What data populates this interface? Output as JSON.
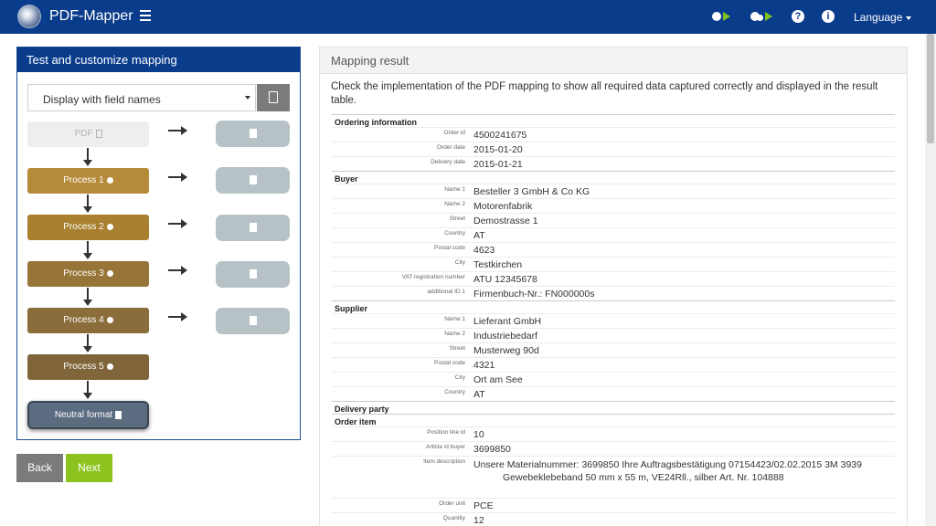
{
  "app": {
    "title": "PDF-Mapper",
    "language_label": "Language"
  },
  "toolbar": {
    "icons": [
      "gear-play-icon",
      "gears-play-icon",
      "help-icon",
      "info-icon"
    ],
    "help_glyph": "?",
    "info_glyph": "i"
  },
  "left_panel": {
    "title": "Test and customize mapping",
    "display_select": "Display with field names",
    "flow": {
      "pdf": "PDF",
      "processes": [
        "Process 1",
        "Process 2",
        "Process 3",
        "Process 4",
        "Process 5"
      ],
      "neutral": "Neutral format"
    },
    "colors": {
      "process": [
        "#b58a39",
        "#a8802f",
        "#977437",
        "#8b6d3b",
        "#7f6539"
      ]
    }
  },
  "buttons": {
    "back": "Back",
    "next": "Next"
  },
  "right_panel": {
    "title": "Mapping result",
    "intro": "Check the implementation of the PDF mapping to show all required data captured correctly and displayed in the result table.",
    "sections": {
      "ordering": {
        "title": "Ordering information",
        "rows": [
          {
            "label": "Order id",
            "value": "4500241675"
          },
          {
            "label": "Order date",
            "value": "2015-01-20"
          },
          {
            "label": "Delivery date",
            "value": "2015-01-21"
          }
        ]
      },
      "buyer": {
        "title": "Buyer",
        "rows": [
          {
            "label": "Name 1",
            "value": "Besteller 3 GmbH & Co KG"
          },
          {
            "label": "Name 2",
            "value": "Motorenfabrik"
          },
          {
            "label": "Street",
            "value": "Demostrasse 1"
          },
          {
            "label": "Country",
            "value": "AT"
          },
          {
            "label": "Postal code",
            "value": "4623"
          },
          {
            "label": "City",
            "value": "Testkirchen"
          },
          {
            "label": "VAT registration number",
            "value": "ATU 12345678"
          },
          {
            "label": "additional ID 1",
            "value": "Firmenbuch-Nr.: FN000000s"
          }
        ]
      },
      "supplier": {
        "title": "Supplier",
        "rows": [
          {
            "label": "Name 1",
            "value": "Lieferant GmbH"
          },
          {
            "label": "Name 2",
            "value": "Industriebedarf"
          },
          {
            "label": "Street",
            "value": "Musterweg 90d"
          },
          {
            "label": "Postal code",
            "value": "4321"
          },
          {
            "label": "City",
            "value": "Ort am See"
          },
          {
            "label": "Country",
            "value": "AT"
          }
        ]
      },
      "delivery_party": {
        "title": "Delivery party"
      },
      "order_item": {
        "title": "Order item",
        "rows": [
          {
            "label": "Position line id",
            "value": "10"
          },
          {
            "label": "Article id buyer",
            "value": "3699850"
          }
        ],
        "description": {
          "label": "Item description",
          "line1": "Unsere Materialnummer: 3699850 Ihre Auftragsbestätigung 07154423/02.02.2015 3M 3939",
          "line2": "Gewebeklebeband 50 mm x 55 m, VE24Rll., silber Art. Nr. 104888"
        },
        "rows_after": [
          {
            "label": "Order unit",
            "value": "PCE"
          },
          {
            "label": "Quantity",
            "value": "12"
          }
        ]
      }
    }
  }
}
